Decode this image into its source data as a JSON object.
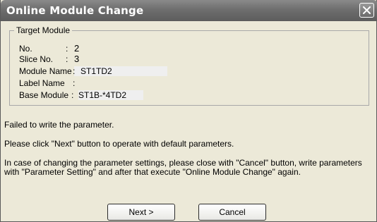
{
  "dialog": {
    "title": "Online Module Change",
    "close_icon": "close-icon"
  },
  "target_module": {
    "legend": "Target Module",
    "fields": [
      {
        "label": "No.",
        "value": "2"
      },
      {
        "label": "Slice No.",
        "value": "3"
      },
      {
        "label": "Module Name",
        "value": "ST1TD2"
      },
      {
        "label": "Label Name",
        "value": ""
      },
      {
        "label": "Base Module",
        "value": "ST1B-*4TD2"
      }
    ]
  },
  "messages": {
    "error": "Failed to write the parameter.",
    "instruction": "Please click \"Next\" button to operate with default parameters.",
    "change_info": "In case of changing the parameter settings, please close with \"Cancel\" button, write parameters with \"Parameter Setting\" and after that execute \"Online Module Change\" again."
  },
  "buttons": {
    "next": "Next >",
    "cancel": "Cancel"
  }
}
